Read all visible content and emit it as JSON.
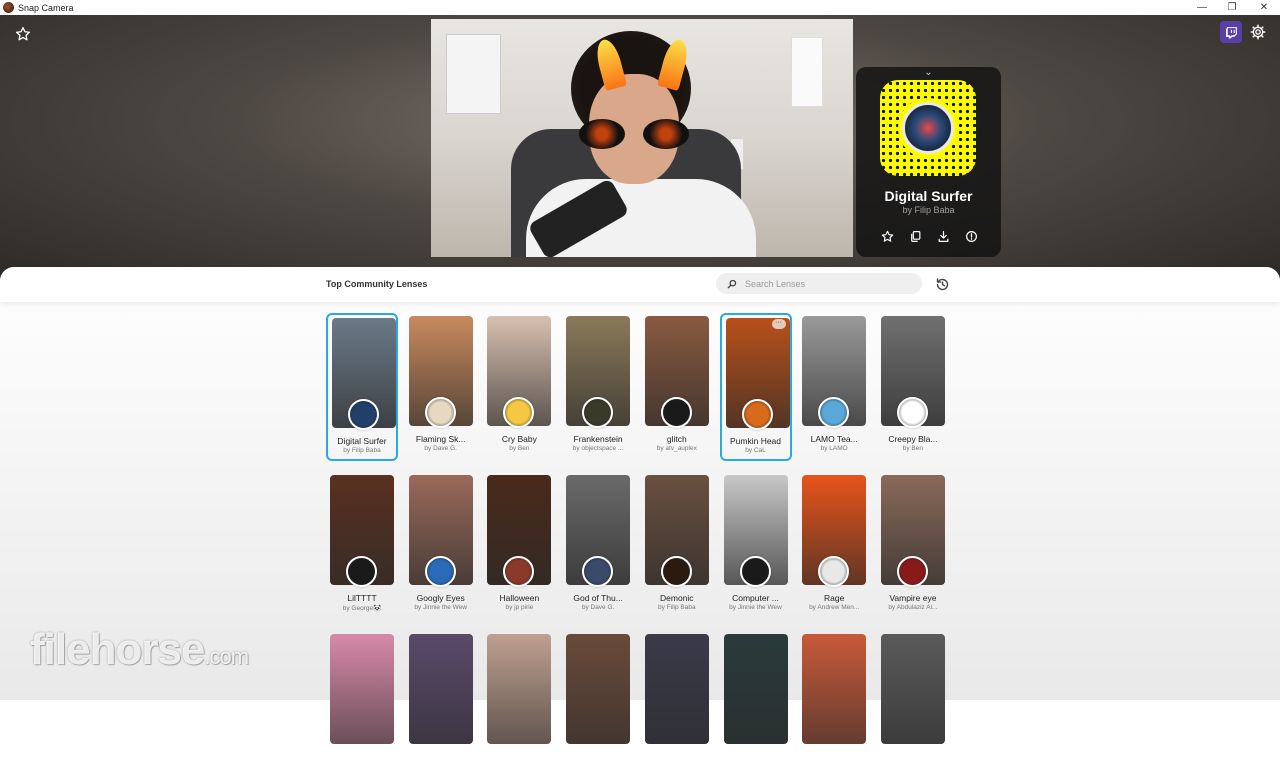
{
  "window": {
    "title": "Snap Camera",
    "controls": {
      "minimize": "—",
      "maximize": "❐",
      "close": "✕"
    }
  },
  "hero": {
    "favorites_icon": "star-outline-icon",
    "twitch_icon": "twitch-icon",
    "settings_icon": "gear-icon"
  },
  "active_lens": {
    "name": "Digital Surfer",
    "author": "by Filip Baba",
    "collapse_icon": "chevron-down-icon",
    "actions": [
      {
        "name": "favorite",
        "icon": "star-icon"
      },
      {
        "name": "copy-link",
        "icon": "copy-icon"
      },
      {
        "name": "download",
        "icon": "download-icon"
      },
      {
        "name": "report",
        "icon": "info-icon"
      }
    ]
  },
  "lens_panel": {
    "heading": "Top Community Lenses",
    "search_placeholder": "Search Lenses",
    "history_icon": "history-icon"
  },
  "lenses": [
    {
      "name": "Digital Surfer",
      "author": "by Filip Baba",
      "selected": true,
      "thumb": "#6b7a88",
      "badge": "#20406a"
    },
    {
      "name": "Flaming Sk...",
      "author": "by Dave G.",
      "selected": false,
      "thumb": "#c98a5e",
      "badge": "#e8d8c0"
    },
    {
      "name": "Cry Baby",
      "author": "by Ben",
      "selected": false,
      "thumb": "#d8c0b0",
      "badge": "#f5c842"
    },
    {
      "name": "Frankenstein",
      "author": "by objectspace ...",
      "selected": false,
      "thumb": "#8a7a5a",
      "badge": "#3a3a2a"
    },
    {
      "name": "glitch",
      "author": "by atv_auplex",
      "selected": false,
      "thumb": "#8a5a40",
      "badge": "#1a1a1a"
    },
    {
      "name": "Pumkin Head",
      "author": "by CaL",
      "selected": true,
      "thumb": "#b8501a",
      "badge": "#d86a1a"
    },
    {
      "name": "LAMO Tea...",
      "author": "by LAMO",
      "selected": false,
      "thumb": "#9a9a9a",
      "badge": "#5aa8d8"
    },
    {
      "name": "Creepy Bla...",
      "author": "by Ben",
      "selected": false,
      "thumb": "#707070",
      "badge": "#ffffff"
    },
    {
      "name": "LilTTTT",
      "author": "by George🐼",
      "selected": false,
      "thumb": "#5a3020",
      "badge": "#1a1a1a"
    },
    {
      "name": "Googly Eyes",
      "author": "by Jinnie the Wew",
      "selected": false,
      "thumb": "#9a6a5a",
      "badge": "#2a6ab8"
    },
    {
      "name": "Halloween",
      "author": "by jp pirie",
      "selected": false,
      "thumb": "#4a2a1a",
      "badge": "#8a3a2a"
    },
    {
      "name": "God of Thu...",
      "author": "by Dave G.",
      "selected": false,
      "thumb": "#6a6a6a",
      "badge": "#3a4a6a"
    },
    {
      "name": "Demonic",
      "author": "by Filip Baba",
      "selected": false,
      "thumb": "#6a5040",
      "badge": "#2a1a10"
    },
    {
      "name": "Computer ...",
      "author": "by Jinnie the Wew",
      "selected": false,
      "thumb": "#c8c8c8",
      "badge": "#1a1a1a"
    },
    {
      "name": "Rage",
      "author": "by Andrew Men...",
      "selected": false,
      "thumb": "#e8541a",
      "badge": "#e8e8e8"
    },
    {
      "name": "Vampire eye",
      "author": "by Abdulaziz Al...",
      "selected": false,
      "thumb": "#8a6a5a",
      "badge": "#8a1a1a"
    }
  ],
  "lenses_row3_thumbs": [
    "#d88aa8",
    "#5a4a6a",
    "#c0a090",
    "#6a4a3a",
    "#3a3a4a",
    "#2a3a3a",
    "#c85a3a",
    "#5a5a5a"
  ],
  "watermark": {
    "brand": "filehorse",
    "tld": ".com"
  }
}
